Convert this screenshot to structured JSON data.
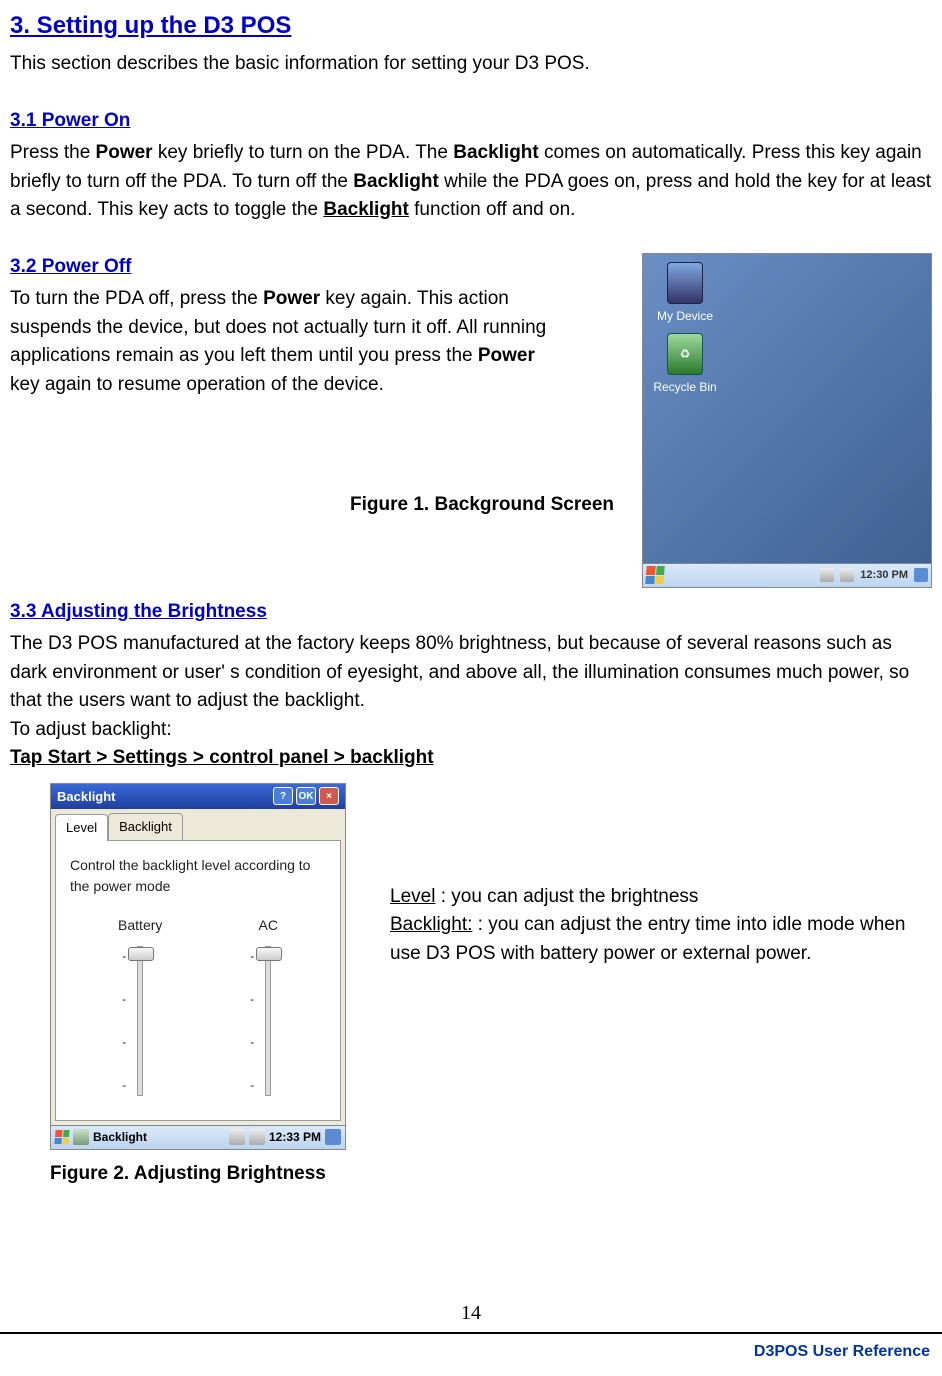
{
  "page": {
    "title": "3. Setting up the D3 POS",
    "intro": "This section describes the basic information for setting your D3 POS.",
    "number": "14",
    "footer": "D3POS User Reference"
  },
  "s31": {
    "heading": "3.1 Power On",
    "text1": "Press the ",
    "bold1": "Power",
    "text2": " key briefly to turn on the PDA. The ",
    "bold2": "Backlight",
    "text3": " comes on automatically. Press this key again briefly to turn off the PDA. To turn off the ",
    "bold3": "Backlight",
    "text4": " while the PDA goes on, press and hold the key for at least a second. This key acts to toggle the ",
    "bold4": "Backlight",
    "text5": " function off and on."
  },
  "s32": {
    "heading": "3.2 Power Off",
    "text1": "To turn the PDA off, press the ",
    "bold1": "Power",
    "text2": " key again. This action suspends the device, but does not actually turn it off. All running applications remain as you left them until you press the ",
    "bold2": "Power",
    "text3": " key again to resume operation of the device."
  },
  "fig1": {
    "caption": "Figure 1. Background Screen",
    "icon1": "My Device",
    "icon2": "Recycle Bin",
    "time": "12:30 PM"
  },
  "s33": {
    "heading": "3.3 Adjusting the Brightness",
    "para": "The D3 POS manufactured at the factory keeps 80% brightness, but because of several reasons such as dark environment or user' s condition of eyesight, and above all, the illumination consumes much power, so that the users want to adjust the backlight.",
    "para2": "To adjust backlight:",
    "nav": "Tap Start > Settings > control panel > backlight"
  },
  "fig2": {
    "caption": "Figure 2. Adjusting Brightness",
    "title": "Backlight",
    "help": "?",
    "ok": "OK",
    "close": "×",
    "tab1": "Level",
    "tab2": "Backlight",
    "panel_text": "Control the backlight level according to the power mode",
    "col1": "Battery",
    "col2": "AC",
    "tick": "-",
    "taskbar_label": "Backlight",
    "time": "12:33 PM"
  },
  "desc": {
    "level_label": "Level",
    "level_text": " : you can adjust the brightness",
    "backlight_label": "Backlight:",
    "backlight_text": " : you can adjust the entry time into idle mode when use D3 POS with battery power or external power."
  }
}
